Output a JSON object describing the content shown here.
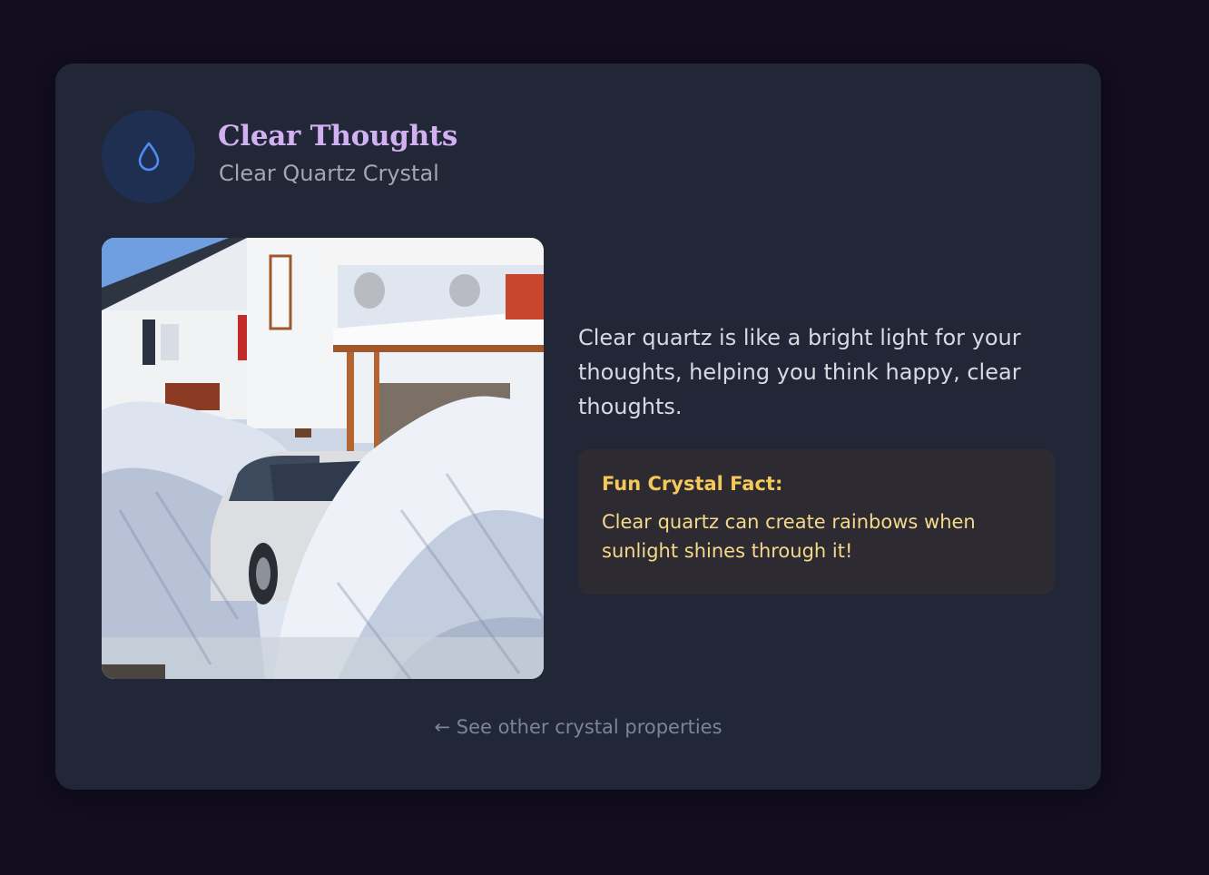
{
  "crystal": {
    "icon": "water-drop-icon",
    "title": "Clear Thoughts",
    "subtitle": "Clear Quartz Crystal",
    "description": "Clear quartz is like a bright light for your thoughts, helping you think happy, clear thoughts.",
    "fact": {
      "title": "Fun Crystal Fact:",
      "text": "Clear quartz can create rainbows when sunlight shines through it!"
    }
  },
  "nav": {
    "back_link": "← See other crystal properties"
  },
  "colors": {
    "page_background": "#120d1f",
    "card_background": "#212736",
    "title_accent": "#d2b1f3",
    "icon_accent": "#4f8cf0",
    "fact_background": "#2d2b31",
    "fact_text": "#f5d98a"
  }
}
